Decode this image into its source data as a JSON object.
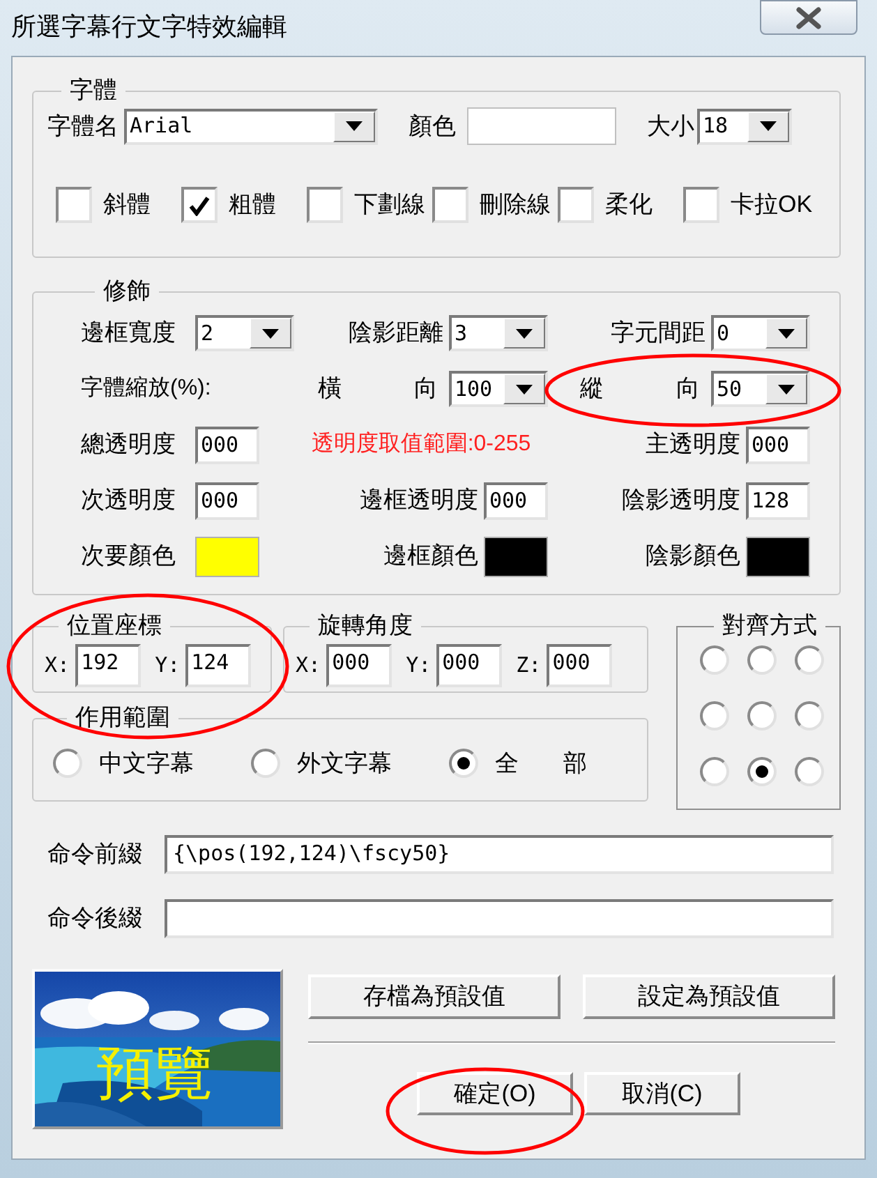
{
  "window": {
    "title": "所選字幕行文字特效編輯"
  },
  "font": {
    "title": "字體",
    "name_label": "字體名",
    "name_value": "Arial",
    "color_label": "顏色",
    "color": "#ffffff",
    "size_label": "大小",
    "size_value": "18",
    "styles": [
      {
        "label": "斜體",
        "checked": false
      },
      {
        "label": "粗體",
        "checked": true
      },
      {
        "label": "下劃線",
        "checked": false
      },
      {
        "label": "刪除線",
        "checked": false
      },
      {
        "label": "柔化",
        "checked": false
      },
      {
        "label": "卡拉OK",
        "checked": false
      }
    ]
  },
  "decoration": {
    "title": "修飾",
    "rows": [
      [
        {
          "kind": "combo",
          "label": "邊框寬度",
          "value": "2"
        },
        {
          "kind": "combo",
          "label": "陰影距離",
          "value": "3"
        },
        {
          "kind": "combo",
          "label": "字元間距",
          "value": "0"
        }
      ],
      [
        {
          "kind": "label",
          "label": "字體縮放(%):"
        },
        {
          "kind": "combo",
          "label": "橫 向",
          "value": "100"
        },
        {
          "kind": "combo",
          "label": "縱 向",
          "value": "50"
        }
      ],
      [
        {
          "kind": "field",
          "label": "總透明度",
          "value": "000"
        },
        {
          "kind": "warning",
          "label": "透明度取值範圍:0-255"
        },
        {
          "kind": "field",
          "label": "主透明度",
          "value": "000"
        }
      ],
      [
        {
          "kind": "field",
          "label": "次透明度",
          "value": "000"
        },
        {
          "kind": "field",
          "label": "邊框透明度",
          "value": "000"
        },
        {
          "kind": "field",
          "label": "陰影透明度",
          "value": "128"
        }
      ],
      [
        {
          "kind": "swatch",
          "label": "次要顏色",
          "color": "#ffff00"
        },
        {
          "kind": "swatch",
          "label": "邊框顏色",
          "color": "#000000"
        },
        {
          "kind": "swatch",
          "label": "陰影顏色",
          "color": "#000000"
        }
      ]
    ]
  },
  "position": {
    "title": "位置座標",
    "fields": [
      {
        "label": "X:",
        "value": "192"
      },
      {
        "label": "Y:",
        "value": "124"
      }
    ]
  },
  "rotation": {
    "title": "旋轉角度",
    "fields": [
      {
        "label": "X:",
        "value": "000"
      },
      {
        "label": "Y:",
        "value": "000"
      },
      {
        "label": "Z:",
        "value": "000"
      }
    ]
  },
  "scope": {
    "title": "作用範圍",
    "options": [
      {
        "label": "中文字幕",
        "selected": false
      },
      {
        "label": "外文字幕",
        "selected": false
      },
      {
        "label": "全 部",
        "selected": true
      }
    ]
  },
  "alignment": {
    "title": "對齊方式",
    "options": [
      {
        "selected": false
      },
      {
        "selected": false
      },
      {
        "selected": false
      },
      {
        "selected": false
      },
      {
        "selected": false
      },
      {
        "selected": false
      },
      {
        "selected": false
      },
      {
        "selected": true
      },
      {
        "selected": false
      }
    ]
  },
  "commands": [
    {
      "label": "命令前綴",
      "value": "{\\pos(192,124)\\fscy50}"
    },
    {
      "label": "命令後綴"
    }
  ],
  "preview": {
    "kind": "picture",
    "text": "預覽"
  },
  "default_buttons": [
    {
      "label": "存檔為預設值"
    },
    {
      "label": "設定為預設值"
    }
  ],
  "dialog_buttons": [
    {
      "label": "確定(O)"
    },
    {
      "label": "取消(C)"
    }
  ]
}
